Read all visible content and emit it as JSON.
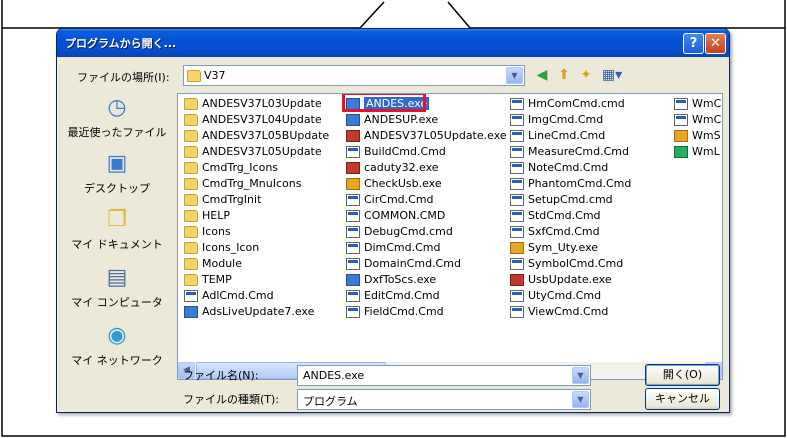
{
  "dialog": {
    "title": "プログラムから開く...",
    "help_glyph": "?",
    "close_glyph": "✕"
  },
  "location": {
    "label": "ファイルの場所(I):",
    "value": "V37"
  },
  "places": [
    {
      "label": "最近使ったファイル",
      "icon": "recent-documents-icon"
    },
    {
      "label": "デスクトップ",
      "icon": "desktop-icon"
    },
    {
      "label": "マイ ドキュメント",
      "icon": "my-documents-icon"
    },
    {
      "label": "マイ コンピュータ",
      "icon": "my-computer-icon"
    },
    {
      "label": "マイ ネットワーク",
      "icon": "my-network-icon"
    }
  ],
  "files": {
    "col1": [
      {
        "name": "ANDESV37L03Update",
        "type": "folder"
      },
      {
        "name": "ANDESV37L04Update",
        "type": "folder"
      },
      {
        "name": "ANDESV37L05BUpdate",
        "type": "folder"
      },
      {
        "name": "ANDESV37L05Update",
        "type": "folder"
      },
      {
        "name": "CmdTrg_Icons",
        "type": "folder"
      },
      {
        "name": "CmdTrg_MnuIcons",
        "type": "folder"
      },
      {
        "name": "CmdTrgInit",
        "type": "folder"
      },
      {
        "name": "HELP",
        "type": "folder"
      },
      {
        "name": "Icons",
        "type": "folder"
      },
      {
        "name": "Icons_Icon",
        "type": "folder"
      },
      {
        "name": "Module",
        "type": "folder"
      },
      {
        "name": "TEMP",
        "type": "folder"
      },
      {
        "name": "AdlCmd.Cmd",
        "type": "cmd"
      },
      {
        "name": "AdsLiveUpdate7.exe",
        "type": "exe"
      }
    ],
    "col2": [
      {
        "name": "ANDES.exe",
        "type": "exe",
        "selected": true
      },
      {
        "name": "ANDESUP.exe",
        "type": "exe"
      },
      {
        "name": "ANDESV37L05Update.exe",
        "type": "exe2"
      },
      {
        "name": "BuildCmd.Cmd",
        "type": "cmd"
      },
      {
        "name": "caduty32.exe",
        "type": "exe2"
      },
      {
        "name": "CheckUsb.exe",
        "type": "exe3"
      },
      {
        "name": "CirCmd.Cmd",
        "type": "cmd"
      },
      {
        "name": "COMMON.CMD",
        "type": "cmd"
      },
      {
        "name": "DebugCmd.cmd",
        "type": "cmd"
      },
      {
        "name": "DimCmd.Cmd",
        "type": "cmd"
      },
      {
        "name": "DomainCmd.Cmd",
        "type": "cmd"
      },
      {
        "name": "DxfToScs.exe",
        "type": "exe"
      },
      {
        "name": "EditCmd.Cmd",
        "type": "cmd"
      },
      {
        "name": "FieldCmd.Cmd",
        "type": "cmd"
      }
    ],
    "col3": [
      {
        "name": "HmComCmd.cmd",
        "type": "cmd"
      },
      {
        "name": "ImgCmd.Cmd",
        "type": "cmd"
      },
      {
        "name": "LineCmd.Cmd",
        "type": "cmd"
      },
      {
        "name": "MeasureCmd.Cmd",
        "type": "cmd"
      },
      {
        "name": "NoteCmd.Cmd",
        "type": "cmd"
      },
      {
        "name": "PhantomCmd.Cmd",
        "type": "cmd"
      },
      {
        "name": "SetupCmd.cmd",
        "type": "cmd"
      },
      {
        "name": "StdCmd.Cmd",
        "type": "cmd"
      },
      {
        "name": "SxfCmd.Cmd",
        "type": "cmd"
      },
      {
        "name": "Sym_Uty.exe",
        "type": "exe3"
      },
      {
        "name": "SymbolCmd.Cmd",
        "type": "cmd"
      },
      {
        "name": "UsbUpdate.exe",
        "type": "exe2"
      },
      {
        "name": "UtyCmd.Cmd",
        "type": "cmd"
      },
      {
        "name": "ViewCmd.Cmd",
        "type": "cmd"
      }
    ],
    "col4": [
      {
        "name": "WmC",
        "type": "cmd"
      },
      {
        "name": "WmC",
        "type": "cmd"
      },
      {
        "name": "WmS",
        "type": "exe3"
      },
      {
        "name": "WmL",
        "type": "exe4"
      }
    ]
  },
  "filename": {
    "label": "ファイル名(N):",
    "value": "ANDES.exe"
  },
  "filetype": {
    "label": "ファイルの種類(T):",
    "value": "プログラム"
  },
  "buttons": {
    "open": "開く(O)",
    "cancel": "キャンセル"
  }
}
